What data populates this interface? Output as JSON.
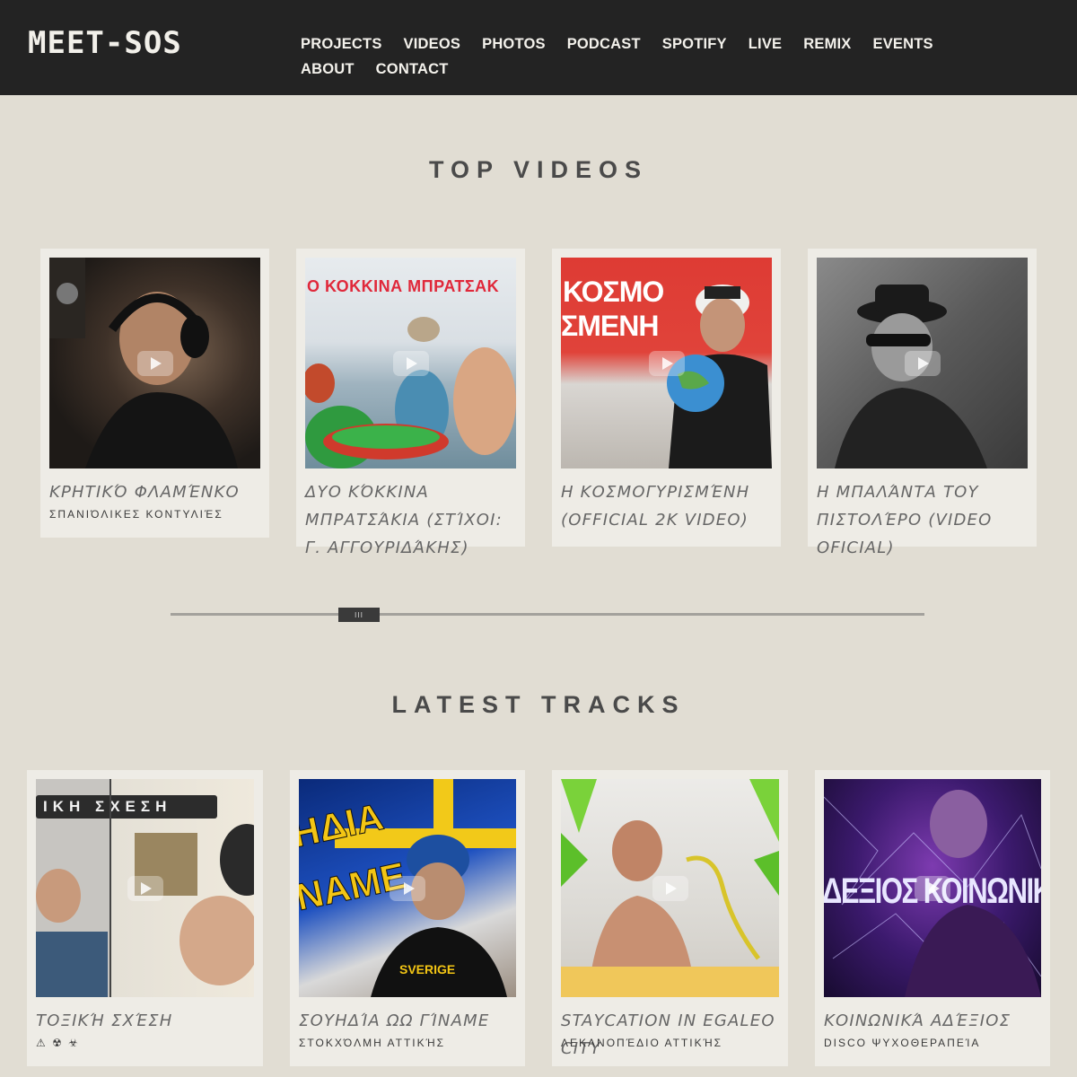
{
  "header": {
    "logo": "MEET-SOS",
    "nav": [
      "PROJECTS",
      "VIDEOS",
      "PHOTOS",
      "PODCAST",
      "SPOTIFY",
      "LIVE",
      "REMIX",
      "EVENTS",
      "ABOUT",
      "CONTACT"
    ]
  },
  "top_videos": {
    "title": "TOP VIDEOS",
    "items": [
      {
        "title": "Κρητικό Φλαμένκο",
        "subtitle": "Σπανιόλικες Κοντυλιές"
      },
      {
        "title": "Δυο κόκκινα μπρατσάκια (στίχοι: Γ. Αγγουριδάκης)",
        "subtitle": "",
        "thumb_text": "Ο ΚΟΚΚΙΝΑ ΜΠΡΑΤΣΑΚ"
      },
      {
        "title": "Η Κοσμογυρισμένη (Official 2K Video)",
        "subtitle": "",
        "thumb_text_1": "ΚΟΣΜΟ",
        "thumb_text_2": "ΣΜΕΝΗ"
      },
      {
        "title": "Η Μπαλάντα του Πιστολέρο (Video Oficial)",
        "subtitle": ""
      }
    ]
  },
  "latest_tracks": {
    "title": "LATEST TRACKS",
    "items": [
      {
        "title": "Τοξική Σχέση",
        "subtitle": "⚠ ☢ ☣",
        "thumb_text": "ΙΚΗ  ΣΧΕΣΗ"
      },
      {
        "title": "Σουηδία ωω γίναμε",
        "subtitle": "Στοκχόλμη Αττικής",
        "thumb_text_1": "ΗΔΙΑ",
        "thumb_text_2": "NAME",
        "shirt_text": "SVERIGE"
      },
      {
        "title": "Staycation in Egaleo City",
        "subtitle": "Λεκανοπέδιο Αττικής"
      },
      {
        "title": "Κοινωνικά Αδέξιος",
        "subtitle": "Disco Ψυχοθεραπεία",
        "thumb_text": "ΔΕΞΙΟΣ ΚΟΙΝΩΝΙΚ"
      }
    ]
  },
  "slider": {
    "handle_label": "III"
  }
}
